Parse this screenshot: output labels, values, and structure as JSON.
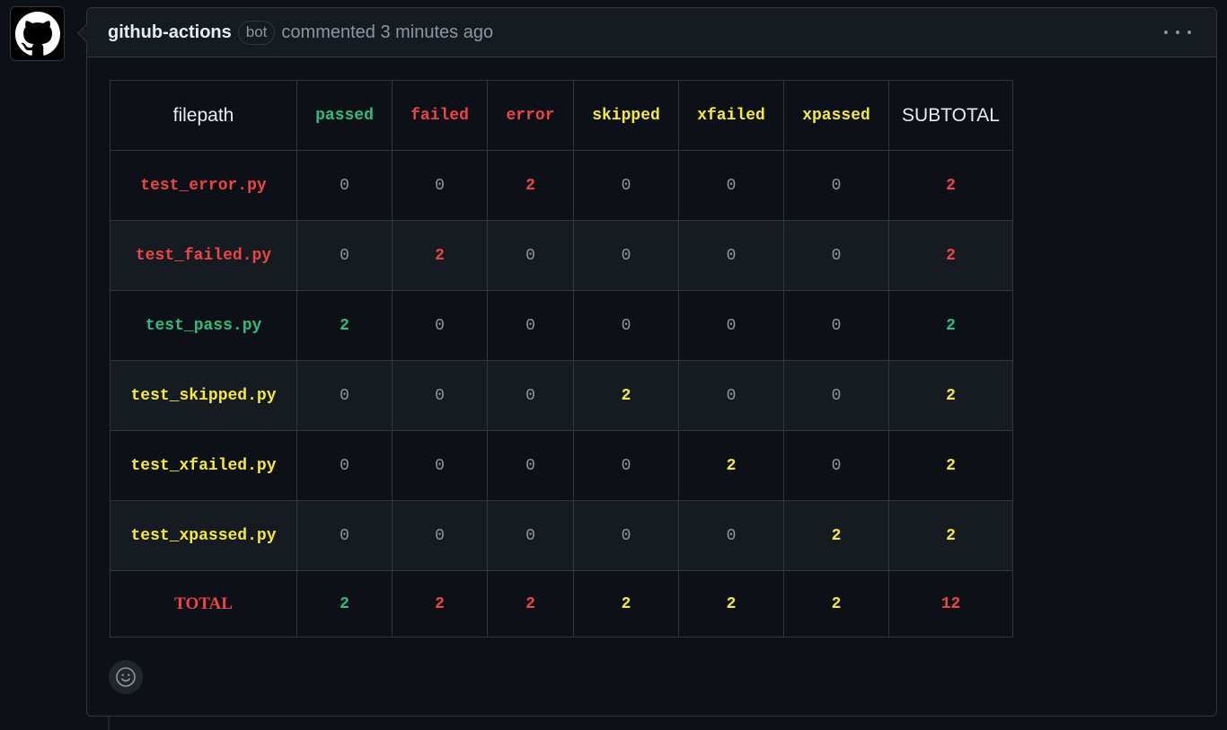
{
  "colors": {
    "passed": "#3fb950",
    "green_cell": "#2ebd7d",
    "red": "#ef4444",
    "yellow": "#f5ea39",
    "zero": "#8d96a0",
    "white": "#e6edf3"
  },
  "comment": {
    "author": "github-actions",
    "badge": "bot",
    "meta": "commented 3 minutes ago",
    "avatar_icon": "github-mark-icon",
    "menu_icon": "kebab-horizontal-icon",
    "reaction_icon": "smiley-icon"
  },
  "table": {
    "headers": [
      "filepath",
      "passed",
      "failed",
      "error",
      "skipped",
      "xfailed",
      "xpassed",
      "SUBTOTAL"
    ],
    "header_colors": [
      "white",
      "green_cell",
      "red",
      "red",
      "yellow",
      "yellow",
      "yellow",
      "white"
    ],
    "rows": [
      {
        "file": "test_error.py",
        "file_color": "red",
        "values": [
          "0",
          "0",
          "2",
          "0",
          "0",
          "0",
          "2"
        ],
        "colors": [
          "zero",
          "zero",
          "red",
          "zero",
          "zero",
          "zero",
          "red"
        ]
      },
      {
        "file": "test_failed.py",
        "file_color": "red",
        "values": [
          "0",
          "2",
          "0",
          "0",
          "0",
          "0",
          "2"
        ],
        "colors": [
          "zero",
          "red",
          "zero",
          "zero",
          "zero",
          "zero",
          "red"
        ]
      },
      {
        "file": "test_pass.py",
        "file_color": "green_cell",
        "values": [
          "2",
          "0",
          "0",
          "0",
          "0",
          "0",
          "2"
        ],
        "colors": [
          "green_cell",
          "zero",
          "zero",
          "zero",
          "zero",
          "zero",
          "green_cell"
        ]
      },
      {
        "file": "test_skipped.py",
        "file_color": "yellow",
        "values": [
          "0",
          "0",
          "0",
          "2",
          "0",
          "0",
          "2"
        ],
        "colors": [
          "zero",
          "zero",
          "zero",
          "yellow",
          "zero",
          "zero",
          "yellow"
        ]
      },
      {
        "file": "test_xfailed.py",
        "file_color": "yellow",
        "values": [
          "0",
          "0",
          "0",
          "0",
          "2",
          "0",
          "2"
        ],
        "colors": [
          "zero",
          "zero",
          "zero",
          "zero",
          "yellow",
          "zero",
          "yellow"
        ]
      },
      {
        "file": "test_xpassed.py",
        "file_color": "yellow",
        "values": [
          "0",
          "0",
          "0",
          "0",
          "0",
          "2",
          "2"
        ],
        "colors": [
          "zero",
          "zero",
          "zero",
          "zero",
          "zero",
          "yellow",
          "yellow"
        ]
      }
    ],
    "total": {
      "label": "TOTAL",
      "label_color": "red",
      "values": [
        "2",
        "2",
        "2",
        "2",
        "2",
        "2",
        "12"
      ],
      "colors": [
        "green_cell",
        "red",
        "red",
        "yellow",
        "yellow",
        "yellow",
        "red"
      ]
    }
  }
}
